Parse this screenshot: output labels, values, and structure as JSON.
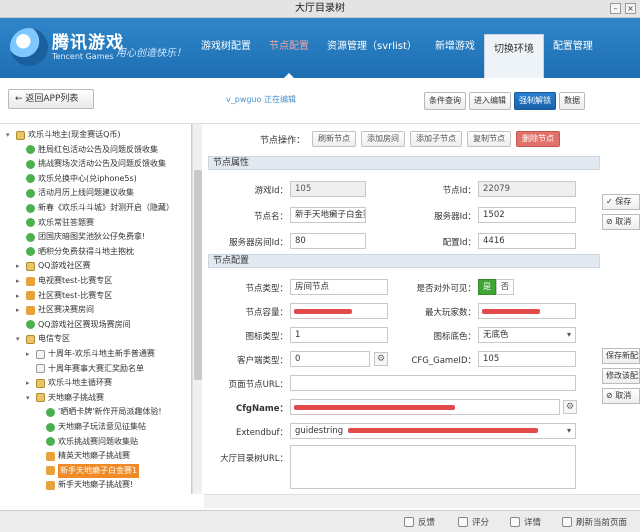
{
  "window": {
    "title": "大厅目录树"
  },
  "header": {
    "logo_cn": "腾讯游戏",
    "logo_en": "Tencent Games",
    "slogan": "用心创造快乐！",
    "nav": [
      {
        "label": "游戏树配置"
      },
      {
        "label": "节点配置"
      },
      {
        "label": "资源管理（svrlist）"
      },
      {
        "label": "新增游戏"
      },
      {
        "label": "切换环境"
      },
      {
        "label": "配置管理"
      }
    ]
  },
  "toolbar": {
    "back_label": "← 返回APP列表",
    "editing_text": "v_pwguo 正在编辑",
    "buttons": [
      {
        "label": "条件查询"
      },
      {
        "label": "进入编辑"
      },
      {
        "label": "强制解锁"
      },
      {
        "label": "数据"
      }
    ]
  },
  "tree": {
    "items": [
      {
        "label": "欢乐斗地主(现金赛话Q币)",
        "level": 0,
        "icon": "folder-icon",
        "expand": "▾"
      },
      {
        "label": "胜局红包活动公告及问题反馈收集",
        "level": 1,
        "icon": "green-circle-icon"
      },
      {
        "label": "挑战赛场次活动公告及问题反馈收集",
        "level": 1,
        "icon": "green-circle-icon"
      },
      {
        "label": "欢乐兑换中心(兑iphone5s)",
        "level": 1,
        "icon": "green-circle-icon"
      },
      {
        "label": "活动月历上线问题建议收集",
        "level": 1,
        "icon": "green-circle-icon"
      },
      {
        "label": "新春《欢乐斗斗城》封测开启（隐藏）",
        "level": 1,
        "icon": "green-circle-icon"
      },
      {
        "label": "欢乐常驻答题赛",
        "level": 1,
        "icon": "green-circle-icon"
      },
      {
        "label": "团国庆暗图奖池狄公仔免费拿!",
        "level": 1,
        "icon": "green-circle-icon"
      },
      {
        "label": "晒积分免费获得斗地主抱枕",
        "level": 1,
        "icon": "green-circle-icon"
      },
      {
        "label": "QQ游戏社区赛",
        "level": 1,
        "icon": "folder-icon",
        "expand": "▸"
      },
      {
        "label": "电视赛test-比赛专区",
        "level": 1,
        "icon": "orange-icon",
        "expand": "▸"
      },
      {
        "label": "社区赛test-比赛专区",
        "level": 1,
        "icon": "orange-icon",
        "expand": "▸"
      },
      {
        "label": "社区赛决赛房间",
        "level": 1,
        "icon": "orange-icon",
        "expand": "▸"
      },
      {
        "label": "QQ游戏社区赛现场赛房间",
        "level": 1,
        "icon": "green-circle-icon"
      },
      {
        "label": "电信专区",
        "level": 1,
        "icon": "folder-icon",
        "expand": "▾"
      },
      {
        "label": "十周年-欢乐斗地主新手普通赛",
        "level": 2,
        "icon": "document-icon",
        "expand": "▸"
      },
      {
        "label": "十周年赛事大赛汇奖励名单",
        "level": 2,
        "icon": "document-icon"
      },
      {
        "label": "欢乐斗地主循环赛",
        "level": 2,
        "icon": "folder-icon",
        "expand": "▸"
      },
      {
        "label": "天地癞子挑战赛",
        "level": 2,
        "icon": "folder-icon",
        "expand": "▾"
      },
      {
        "label": "'晒晒卡牌'新作开局派趣体验!",
        "level": 3,
        "icon": "green-circle-icon"
      },
      {
        "label": "天地癞子玩法意见征集帖",
        "level": 3,
        "icon": "green-circle-icon"
      },
      {
        "label": "欢乐挑战赛问题收集贴",
        "level": 3,
        "icon": "green-circle-icon"
      },
      {
        "label": "精英天地癞子挑战赛",
        "level": 3,
        "icon": "orange-icon"
      },
      {
        "label": "新手天地癞子白金赛1",
        "level": 3,
        "icon": "orange-icon",
        "selected": true
      },
      {
        "label": "新手天地癞子挑战赛!",
        "level": 3,
        "icon": "orange-icon"
      }
    ]
  },
  "node_ops": {
    "label": "节点操作：",
    "buttons": [
      {
        "label": "刷新节点"
      },
      {
        "label": "添加房间"
      },
      {
        "label": "添加子节点"
      },
      {
        "label": "复制节点"
      },
      {
        "label": "删除节点"
      }
    ]
  },
  "props": {
    "section_title": "节点属性",
    "game_id_label": "游戏Id：",
    "game_id": "105",
    "node_id_label": "节点Id：",
    "node_id": "22079",
    "node_name_label": "节点名：",
    "node_name": "新手天地癞子白金赛1",
    "server_id_label": "服务器Id：",
    "server_id": "1502",
    "server_room_id_label": "服务器房间Id：",
    "server_room_id": "80",
    "config_id_label": "配置Id：",
    "config_id": "4416"
  },
  "config": {
    "section_title": "节点配置",
    "node_type_label": "节点类型：",
    "node_type": "房间节点",
    "visible_label": "是否对外可见：",
    "visible_yes": "是",
    "visible_no": "否",
    "node_capacity_label": "节点容量：",
    "max_players_label": "最大玩家数：",
    "icon_type_label": "图标类型：",
    "icon_type": "1",
    "icon_bg_label": "图标底色：",
    "icon_bg": "无底色",
    "client_type_label": "客户端类型：",
    "client_type": "0",
    "cfg_gameid_label": "CFG_GameID：",
    "cfg_gameid": "105",
    "page_url_label": "页面节点URL：",
    "cfgname_label": "CfgName：",
    "extendbuf_label": "Extendbuf：",
    "extendbuf": "guidestring",
    "lobby_url_label": "大厅目录树URL："
  },
  "side_panel": {
    "buttons": [
      {
        "label": "✓ 保存"
      },
      {
        "label": "⊘ 取消"
      },
      {
        "label": "保存新配置"
      },
      {
        "label": "修改该配置"
      },
      {
        "label": "⊘ 取消"
      }
    ]
  },
  "footer": {
    "items": [
      {
        "label": "反馈"
      },
      {
        "label": "评分"
      },
      {
        "label": "详情"
      },
      {
        "label": "刷新当前页面"
      }
    ]
  }
}
